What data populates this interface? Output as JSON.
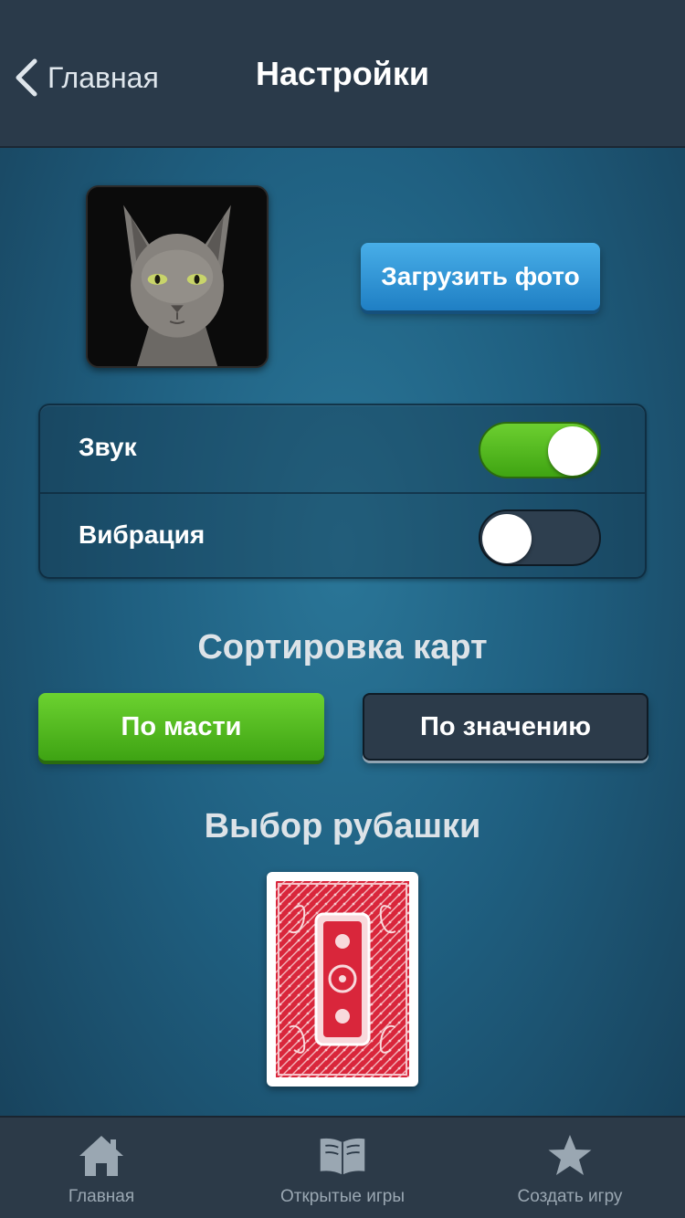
{
  "header": {
    "back_label": "Главная",
    "title": "Настройки"
  },
  "profile": {
    "upload_button": "Загрузить фото"
  },
  "settings": [
    {
      "label": "Звук",
      "on": true
    },
    {
      "label": "Вибрация",
      "on": false
    }
  ],
  "sorting": {
    "title": "Сортировка карт",
    "by_suit": "По масти",
    "by_value": "По значению",
    "selected": "По масти"
  },
  "card_back": {
    "title": "Выбор рубашки"
  },
  "tabbar": {
    "items": [
      {
        "label": "Главная",
        "icon": "home-icon"
      },
      {
        "label": "Открытые игры",
        "icon": "book-icon"
      },
      {
        "label": "Создать игру",
        "icon": "star-icon"
      }
    ]
  },
  "colors": {
    "accent_green": "#4cb81c",
    "accent_blue": "#2a8fd4",
    "header_bg": "#2a3a4a",
    "card_red": "#d9263b"
  }
}
